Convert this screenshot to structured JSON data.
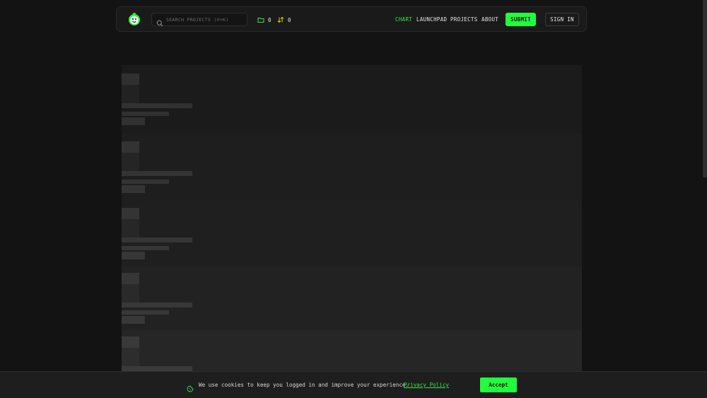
{
  "header": {
    "search_placeholder": "SEARCH PROJECTS (⌘+K)",
    "folder_count": "0",
    "vote_count": "0",
    "nav": [
      "CHART",
      "LAUNCHPAD",
      "PROJECTS",
      "ABOUT"
    ],
    "active_nav": "CHART",
    "submit_label": "SUBMIT",
    "signin_label": "SIGN IN"
  },
  "skeleton_cards": 5,
  "cookie": {
    "text": "We use cookies to keep you logged in and improve your experience.",
    "link_label": "Privacy Policy",
    "accept_label": "Accept"
  },
  "colors": {
    "accent": "#1fff3e",
    "accent_text": "#38e54d",
    "vote_icon": "#e8c51b",
    "background": "#131313"
  },
  "icons": {
    "logo": "mascot-logo-icon",
    "search": "search-icon",
    "folder": "folder-icon",
    "vote": "up-down-arrows-icon",
    "cookie": "cookie-icon"
  }
}
